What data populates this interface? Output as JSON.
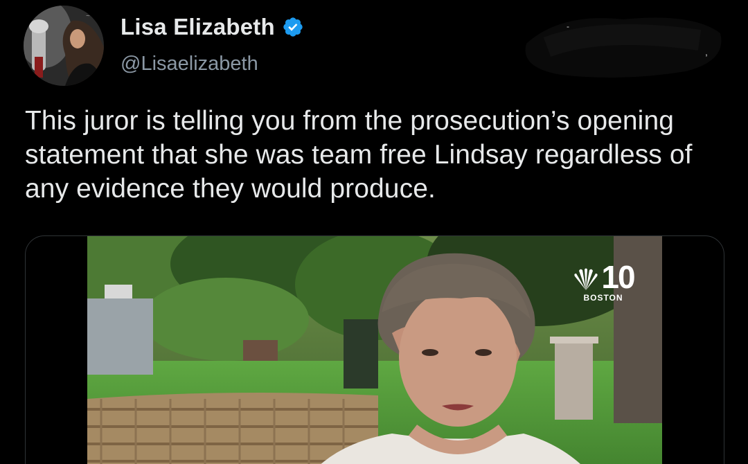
{
  "author": {
    "display_name": "Lisa Elizabeth",
    "handle": "@Lisaelizabeth",
    "verified_icon": "verified-badge-icon",
    "verified_color": "#1d9bf0"
  },
  "tweet": {
    "text": "This juror is telling you from the prosecution’s opening statement that she was team free Lindsay regardless of any evidence they would produce."
  },
  "media": {
    "type": "video",
    "broadcaster_logo": {
      "number": "10",
      "city": "BOSTON"
    }
  },
  "colors": {
    "background": "#000000",
    "text_primary": "#e7e9ea",
    "text_secondary": "#8b98a5",
    "accent": "#1d9bf0"
  }
}
